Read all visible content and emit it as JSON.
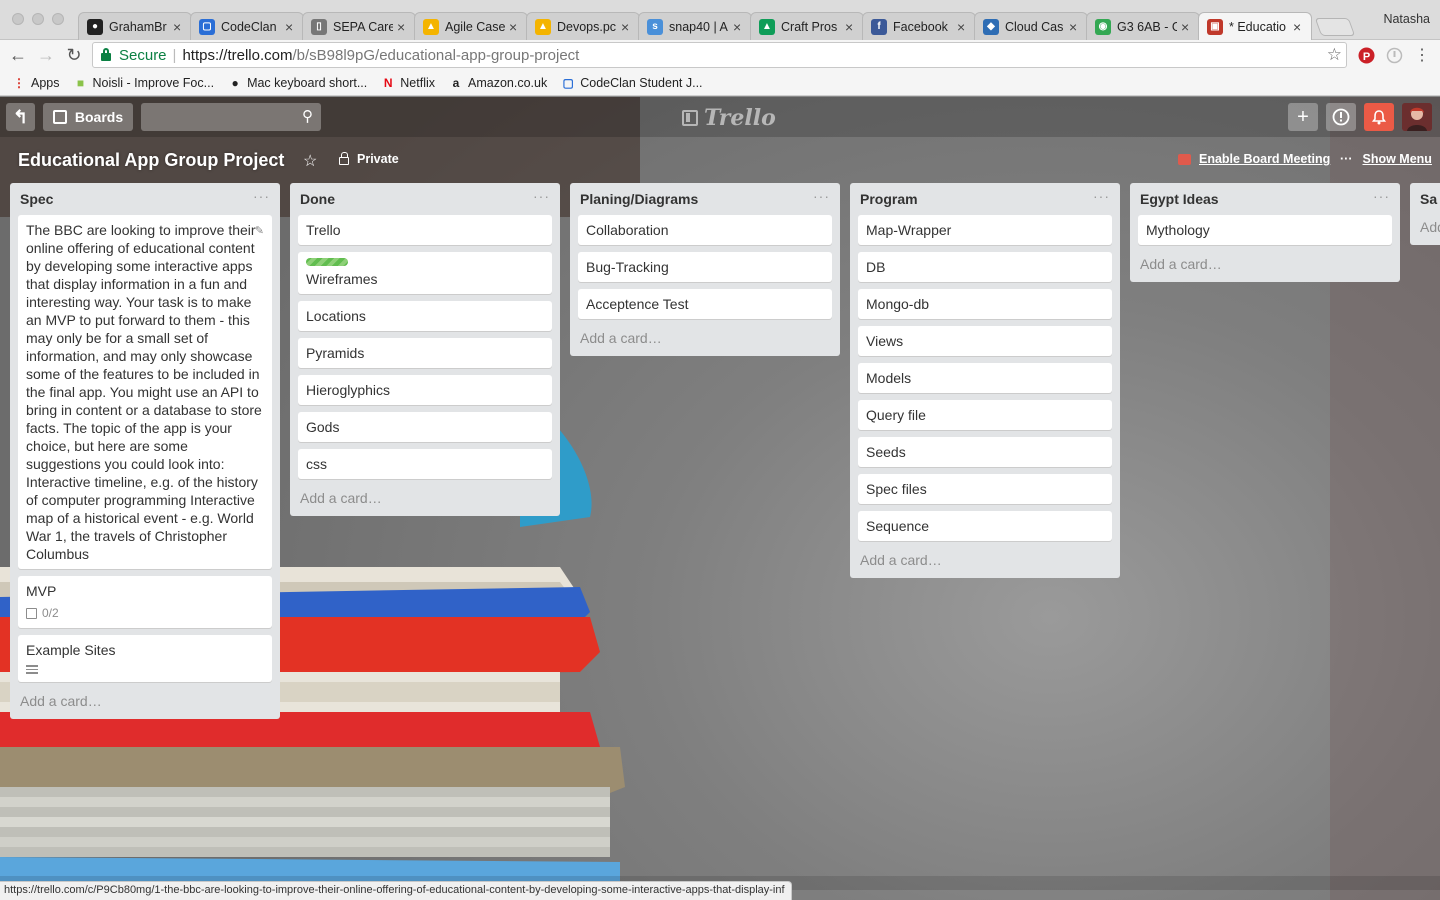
{
  "browser": {
    "tabs": [
      {
        "label": "GrahamBr",
        "icon": "github-icon",
        "color": "#222222",
        "glyph": "●"
      },
      {
        "label": "CodeClan",
        "icon": "page-icon",
        "color": "#2a6ed6",
        "glyph": "▢"
      },
      {
        "label": "SEPA Care",
        "icon": "document-icon",
        "color": "#777777",
        "glyph": "▯"
      },
      {
        "label": "Agile Case",
        "icon": "google-drive-icon",
        "color": "#f4b400",
        "glyph": "▲"
      },
      {
        "label": "Devops.pc",
        "icon": "google-drive-icon",
        "color": "#f4b400",
        "glyph": "▲"
      },
      {
        "label": "snap40 | A",
        "icon": "snap40-icon",
        "color": "#4a90d9",
        "glyph": "s"
      },
      {
        "label": "Craft Pros",
        "icon": "google-drive-icon",
        "color": "#0f9d58",
        "glyph": "▲"
      },
      {
        "label": "Facebook",
        "icon": "facebook-icon",
        "color": "#3b5998",
        "glyph": "f"
      },
      {
        "label": "Cloud Cas",
        "icon": "cloud-icon",
        "color": "#2e6db4",
        "glyph": "◆"
      },
      {
        "label": "G3 6AB - G",
        "icon": "google-maps-icon",
        "color": "#34a853",
        "glyph": "◉"
      },
      {
        "label": "* Educatio",
        "icon": "trello-icon",
        "color": "#c0392b",
        "glyph": "▣",
        "active": true
      }
    ],
    "user": "Natasha",
    "address": {
      "secure_label": "Secure",
      "url_host": "https://trello.com",
      "url_path": "/b/sB98l9pG/educational-app-group-project"
    },
    "bookmarks": [
      {
        "label": "Apps",
        "icon": "apps-grid-icon",
        "color": "#d93025",
        "glyph": "⋮"
      },
      {
        "label": "Noisli - Improve Foc...",
        "icon": "noisli-icon",
        "color": "#8bc34a",
        "glyph": "■"
      },
      {
        "label": "Mac keyboard short...",
        "icon": "apple-icon",
        "color": "#222222",
        "glyph": "●"
      },
      {
        "label": "Netflix",
        "icon": "netflix-icon",
        "color": "#e50914",
        "glyph": "N"
      },
      {
        "label": "Amazon.co.uk",
        "icon": "amazon-icon",
        "color": "#222222",
        "glyph": "a"
      },
      {
        "label": "CodeClan Student J...",
        "icon": "page-icon",
        "color": "#2a6ed6",
        "glyph": "▢"
      }
    ],
    "status_url": "https://trello.com/c/P9Cb80mg/1-the-bbc-are-looking-to-improve-their-online-offering-of-educational-content-by-developing-some-interactive-apps-that-display-inf"
  },
  "trello": {
    "header": {
      "boards_label": "Boards",
      "logo_text": "Trello"
    },
    "board": {
      "title": "Educational App Group Project",
      "visibility": "Private",
      "meeting_label": "Enable Board Meeting",
      "menu_label": "Show Menu"
    },
    "add_card_label": "Add a card…",
    "lists": [
      {
        "title": "Spec",
        "cards": [
          {
            "title": "The BBC are looking to improve their online offering of educational content by developing some interactive apps that display information in a fun and interesting way. Your task is to make an MVP to put forward to them - this may only be for a small set of information, and may only showcase some of the features to be included in the final app. You might use an API to bring in content or a database to store facts. The topic of the app is your choice, but here are some suggestions you could look into: Interactive timeline, e.g. of the history of computer programming Interactive map of a historical event - e.g. World War 1, the travels of Christopher Columbus"
          },
          {
            "title": "MVP",
            "checklist": "0/2"
          },
          {
            "title": "Example Sites",
            "has_description": true
          }
        ]
      },
      {
        "title": "Done",
        "cards": [
          {
            "title": "Trello"
          },
          {
            "title": "Wireframes",
            "label_color": "#61bd4f"
          },
          {
            "title": "Locations"
          },
          {
            "title": "Pyramids"
          },
          {
            "title": "Hieroglyphics"
          },
          {
            "title": "Gods"
          },
          {
            "title": "css"
          }
        ]
      },
      {
        "title": "Planing/Diagrams",
        "cards": [
          {
            "title": "Collaboration"
          },
          {
            "title": "Bug-Tracking"
          },
          {
            "title": "Acceptence Test"
          }
        ]
      },
      {
        "title": "Program",
        "cards": [
          {
            "title": "Map-Wrapper"
          },
          {
            "title": "DB"
          },
          {
            "title": "Mongo-db"
          },
          {
            "title": "Views"
          },
          {
            "title": "Models"
          },
          {
            "title": "Query file"
          },
          {
            "title": "Seeds"
          },
          {
            "title": "Spec files"
          },
          {
            "title": "Sequence"
          }
        ]
      },
      {
        "title": "Egypt Ideas",
        "cards": [
          {
            "title": "Mythology"
          }
        ]
      },
      {
        "title": "Sa",
        "add_label": "Add"
      }
    ]
  }
}
